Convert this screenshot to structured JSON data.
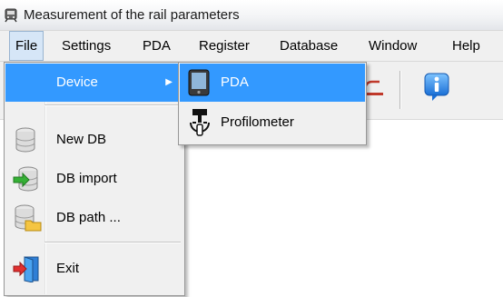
{
  "window": {
    "title": "Measurement of the rail parameters",
    "icon": "train-icon"
  },
  "menubar": {
    "items": [
      "File",
      "Settings",
      "PDA",
      "Register",
      "Database",
      "Window",
      "Help"
    ],
    "open_item": "File"
  },
  "toolbar": {
    "icons": [
      "device-icon",
      "info-icon"
    ]
  },
  "file_menu": {
    "items": [
      {
        "label": "Device",
        "icon": null,
        "has_submenu": true,
        "highlighted": true
      },
      {
        "label": "New DB",
        "icon": "database-icon"
      },
      {
        "label": "DB import",
        "icon": "database-import-icon"
      },
      {
        "label": "DB path ...",
        "icon": "database-folder-icon"
      },
      {
        "label": "Exit",
        "icon": "exit-door-icon"
      }
    ],
    "submenu_arrow": "▶"
  },
  "device_submenu": {
    "items": [
      {
        "label": "PDA",
        "icon": "pda-icon",
        "highlighted": true
      },
      {
        "label": "Profilometer",
        "icon": "profilometer-icon"
      }
    ]
  },
  "colors": {
    "highlight": "#3399ff",
    "menu_background": "#f0f0f0"
  }
}
